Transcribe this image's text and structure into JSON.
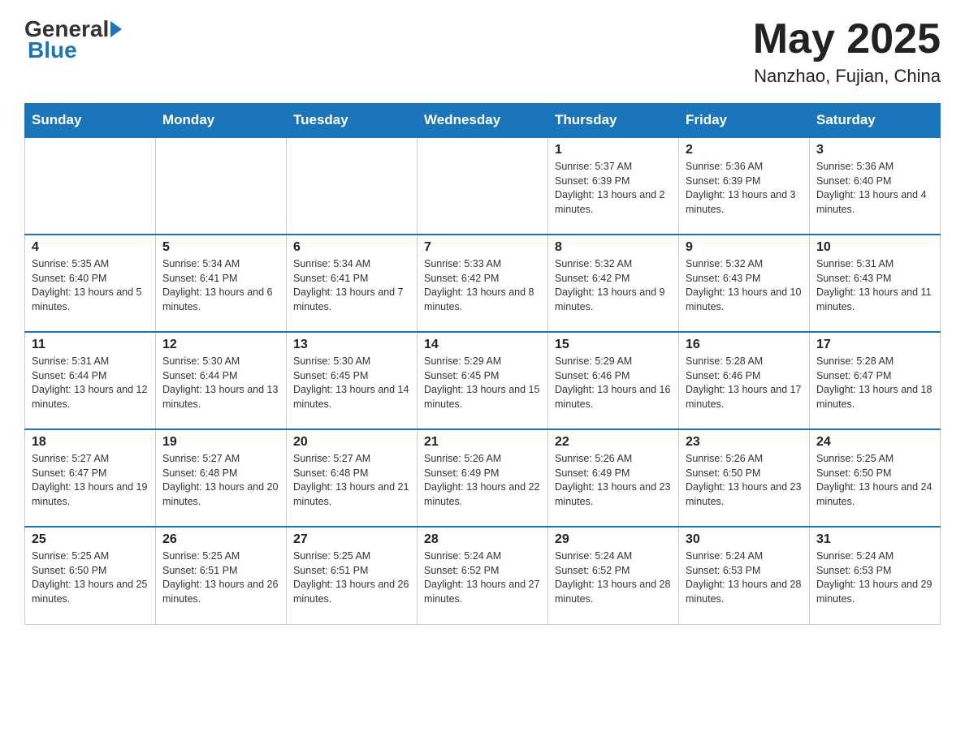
{
  "header": {
    "logo_general": "General",
    "logo_blue": "Blue",
    "month_year": "May 2025",
    "location": "Nanzhao, Fujian, China"
  },
  "days_of_week": [
    "Sunday",
    "Monday",
    "Tuesday",
    "Wednesday",
    "Thursday",
    "Friday",
    "Saturday"
  ],
  "weeks": [
    [
      {
        "day": "",
        "info": ""
      },
      {
        "day": "",
        "info": ""
      },
      {
        "day": "",
        "info": ""
      },
      {
        "day": "",
        "info": ""
      },
      {
        "day": "1",
        "info": "Sunrise: 5:37 AM\nSunset: 6:39 PM\nDaylight: 13 hours and 2 minutes."
      },
      {
        "day": "2",
        "info": "Sunrise: 5:36 AM\nSunset: 6:39 PM\nDaylight: 13 hours and 3 minutes."
      },
      {
        "day": "3",
        "info": "Sunrise: 5:36 AM\nSunset: 6:40 PM\nDaylight: 13 hours and 4 minutes."
      }
    ],
    [
      {
        "day": "4",
        "info": "Sunrise: 5:35 AM\nSunset: 6:40 PM\nDaylight: 13 hours and 5 minutes."
      },
      {
        "day": "5",
        "info": "Sunrise: 5:34 AM\nSunset: 6:41 PM\nDaylight: 13 hours and 6 minutes."
      },
      {
        "day": "6",
        "info": "Sunrise: 5:34 AM\nSunset: 6:41 PM\nDaylight: 13 hours and 7 minutes."
      },
      {
        "day": "7",
        "info": "Sunrise: 5:33 AM\nSunset: 6:42 PM\nDaylight: 13 hours and 8 minutes."
      },
      {
        "day": "8",
        "info": "Sunrise: 5:32 AM\nSunset: 6:42 PM\nDaylight: 13 hours and 9 minutes."
      },
      {
        "day": "9",
        "info": "Sunrise: 5:32 AM\nSunset: 6:43 PM\nDaylight: 13 hours and 10 minutes."
      },
      {
        "day": "10",
        "info": "Sunrise: 5:31 AM\nSunset: 6:43 PM\nDaylight: 13 hours and 11 minutes."
      }
    ],
    [
      {
        "day": "11",
        "info": "Sunrise: 5:31 AM\nSunset: 6:44 PM\nDaylight: 13 hours and 12 minutes."
      },
      {
        "day": "12",
        "info": "Sunrise: 5:30 AM\nSunset: 6:44 PM\nDaylight: 13 hours and 13 minutes."
      },
      {
        "day": "13",
        "info": "Sunrise: 5:30 AM\nSunset: 6:45 PM\nDaylight: 13 hours and 14 minutes."
      },
      {
        "day": "14",
        "info": "Sunrise: 5:29 AM\nSunset: 6:45 PM\nDaylight: 13 hours and 15 minutes."
      },
      {
        "day": "15",
        "info": "Sunrise: 5:29 AM\nSunset: 6:46 PM\nDaylight: 13 hours and 16 minutes."
      },
      {
        "day": "16",
        "info": "Sunrise: 5:28 AM\nSunset: 6:46 PM\nDaylight: 13 hours and 17 minutes."
      },
      {
        "day": "17",
        "info": "Sunrise: 5:28 AM\nSunset: 6:47 PM\nDaylight: 13 hours and 18 minutes."
      }
    ],
    [
      {
        "day": "18",
        "info": "Sunrise: 5:27 AM\nSunset: 6:47 PM\nDaylight: 13 hours and 19 minutes."
      },
      {
        "day": "19",
        "info": "Sunrise: 5:27 AM\nSunset: 6:48 PM\nDaylight: 13 hours and 20 minutes."
      },
      {
        "day": "20",
        "info": "Sunrise: 5:27 AM\nSunset: 6:48 PM\nDaylight: 13 hours and 21 minutes."
      },
      {
        "day": "21",
        "info": "Sunrise: 5:26 AM\nSunset: 6:49 PM\nDaylight: 13 hours and 22 minutes."
      },
      {
        "day": "22",
        "info": "Sunrise: 5:26 AM\nSunset: 6:49 PM\nDaylight: 13 hours and 23 minutes."
      },
      {
        "day": "23",
        "info": "Sunrise: 5:26 AM\nSunset: 6:50 PM\nDaylight: 13 hours and 23 minutes."
      },
      {
        "day": "24",
        "info": "Sunrise: 5:25 AM\nSunset: 6:50 PM\nDaylight: 13 hours and 24 minutes."
      }
    ],
    [
      {
        "day": "25",
        "info": "Sunrise: 5:25 AM\nSunset: 6:50 PM\nDaylight: 13 hours and 25 minutes."
      },
      {
        "day": "26",
        "info": "Sunrise: 5:25 AM\nSunset: 6:51 PM\nDaylight: 13 hours and 26 minutes."
      },
      {
        "day": "27",
        "info": "Sunrise: 5:25 AM\nSunset: 6:51 PM\nDaylight: 13 hours and 26 minutes."
      },
      {
        "day": "28",
        "info": "Sunrise: 5:24 AM\nSunset: 6:52 PM\nDaylight: 13 hours and 27 minutes."
      },
      {
        "day": "29",
        "info": "Sunrise: 5:24 AM\nSunset: 6:52 PM\nDaylight: 13 hours and 28 minutes."
      },
      {
        "day": "30",
        "info": "Sunrise: 5:24 AM\nSunset: 6:53 PM\nDaylight: 13 hours and 28 minutes."
      },
      {
        "day": "31",
        "info": "Sunrise: 5:24 AM\nSunset: 6:53 PM\nDaylight: 13 hours and 29 minutes."
      }
    ]
  ]
}
